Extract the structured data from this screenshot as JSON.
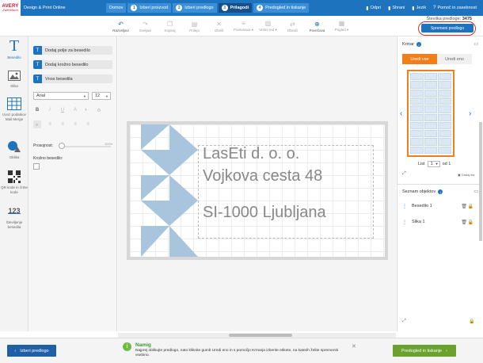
{
  "header": {
    "logo_line1": "AVERY",
    "logo_line2": "Zweckform",
    "app_title": "Design & Print Online",
    "steps": [
      {
        "num": "",
        "label": "Domov"
      },
      {
        "num": "1",
        "label": "Izberi proizvod"
      },
      {
        "num": "2",
        "label": "Izberi predlogo"
      },
      {
        "num": "3",
        "label": "Prilagodi"
      },
      {
        "num": "4",
        "label": "Predogled in tiskanje"
      }
    ],
    "actions": [
      {
        "icon": "folder-open-icon",
        "glyph": "▮",
        "label": "Odpri"
      },
      {
        "icon": "save-icon",
        "glyph": "▮",
        "label": "Shrani"
      },
      {
        "icon": "language-icon",
        "glyph": "▮",
        "label": "Jezik"
      },
      {
        "icon": "help-icon",
        "glyph": "?",
        "label": "Pomoč in zasebnost"
      }
    ]
  },
  "toolbar": {
    "tools": [
      {
        "icon": "undo-icon",
        "glyph": "↶",
        "label": "Razveljavi",
        "active": true
      },
      {
        "icon": "redo-icon",
        "glyph": "↷",
        "label": "Sveljavi",
        "active": false
      },
      {
        "icon": "copy-icon",
        "glyph": "❐",
        "label": "Kopiraj",
        "active": false
      },
      {
        "icon": "paste-icon",
        "glyph": "▤",
        "label": "Prilepi",
        "active": false
      },
      {
        "icon": "delete-icon",
        "glyph": "✕",
        "label": "Izbriši",
        "active": false
      },
      {
        "icon": "align-icon",
        "glyph": "≡",
        "label": "Poravnava ▾",
        "active": false
      },
      {
        "icon": "order-icon",
        "glyph": "▧",
        "label": "Vrstni red ▾",
        "active": false
      },
      {
        "icon": "flip-icon",
        "glyph": "⇄",
        "label": "Obrači",
        "active": false
      },
      {
        "icon": "zoom-icon",
        "glyph": "⊕",
        "label": "Povečava",
        "active": true
      },
      {
        "icon": "view-icon",
        "glyph": "▦",
        "label": "Pogled ▾",
        "active": false
      }
    ],
    "save_status_label": "Številka predloge:",
    "template_number": "3475",
    "save_button": "Spremeni predlogo"
  },
  "rail": [
    {
      "icon": "text-icon",
      "label": "Besedilo"
    },
    {
      "icon": "image-icon",
      "label": "Slika"
    },
    {
      "icon": "mail-merge-icon",
      "label": "Uvoz podatkov Mail Merge"
    },
    {
      "icon": "shape-icon",
      "label": "Oblika"
    },
    {
      "icon": "qr-barcode-icon",
      "label": "QR kode in črtne kode"
    },
    {
      "icon": "numbering-icon",
      "label": "Številjenje besedila"
    }
  ],
  "left_panel": {
    "buttons": [
      {
        "icon": "text-box-icon",
        "glyph": "T",
        "label": "Dodaj polje za besedilo"
      },
      {
        "icon": "circular-text-icon",
        "glyph": "T",
        "label": "Dodaj krožno besedilo"
      },
      {
        "icon": "text-input-icon",
        "glyph": "T",
        "label": "Vnos besedila"
      }
    ],
    "font_value": "Arial",
    "size_value": "12",
    "opacity_label": "Prosojnost:",
    "opacity_value": "100%",
    "circular_label": "Krožno besedilo:"
  },
  "canvas": {
    "lines": [
      "LasEti d. o. o.",
      "Vojkova cesta 48",
      "SI-1000 Ljubljana"
    ]
  },
  "right_panel": {
    "title": "Krmar",
    "tab_all": "Uredi vse",
    "tab_one": "Uredi eno",
    "sheet_label": "List",
    "sheet_value": "1",
    "sheet_total": "od 1",
    "add_sheet": "Dodaj list",
    "objects_title": "Seznam objektov",
    "objects": [
      {
        "label": "Besedilo 1"
      },
      {
        "label": "Slika 1"
      }
    ]
  },
  "bottom": {
    "back_button": "Izberi predlogo",
    "tip_title": "Namig",
    "tip_text": "Najprej oblikujte predlogo, nato kliknite gumb Uredi eno in s pomočjo Krmarja izberite etikete, na katerih želite spremeniti vsebino.",
    "next_button": "Predogled in tiskanje"
  }
}
